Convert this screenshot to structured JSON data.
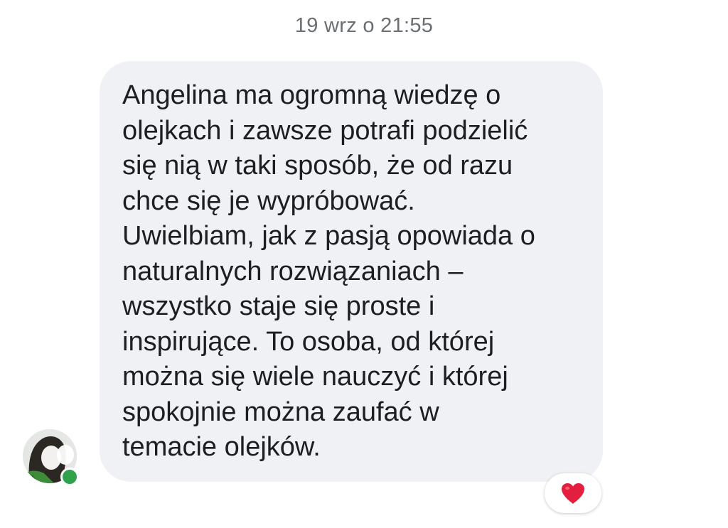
{
  "conversation": {
    "timestamp": "19 wrz o 21:55",
    "message": {
      "text": "Angelina ma ogromną wiedzę o\nolejkach i zawsze potrafi podzielić\nsię nią w taki sposób, że od razu\nchce się je wypróbować.\nUwielbiam, jak z pasją opowiada o\nnaturalnych rozwiązaniach –\nwszystko staje się proste i\ninspirujące. To osoba, od której\nmożna się wiele nauczyć i której\nspokojnie można zaufać w\ntemacie olejków."
    },
    "sender": {
      "avatar_icon": "profile-photo",
      "status": "online",
      "status_color": "#31a24c"
    },
    "reaction": {
      "icon": "heart-icon",
      "color": "#e41e3f"
    }
  },
  "theme": {
    "bubble_bg": "#f0f1f5",
    "text_color": "#1c1e21",
    "timestamp_color": "#6b6e73"
  }
}
